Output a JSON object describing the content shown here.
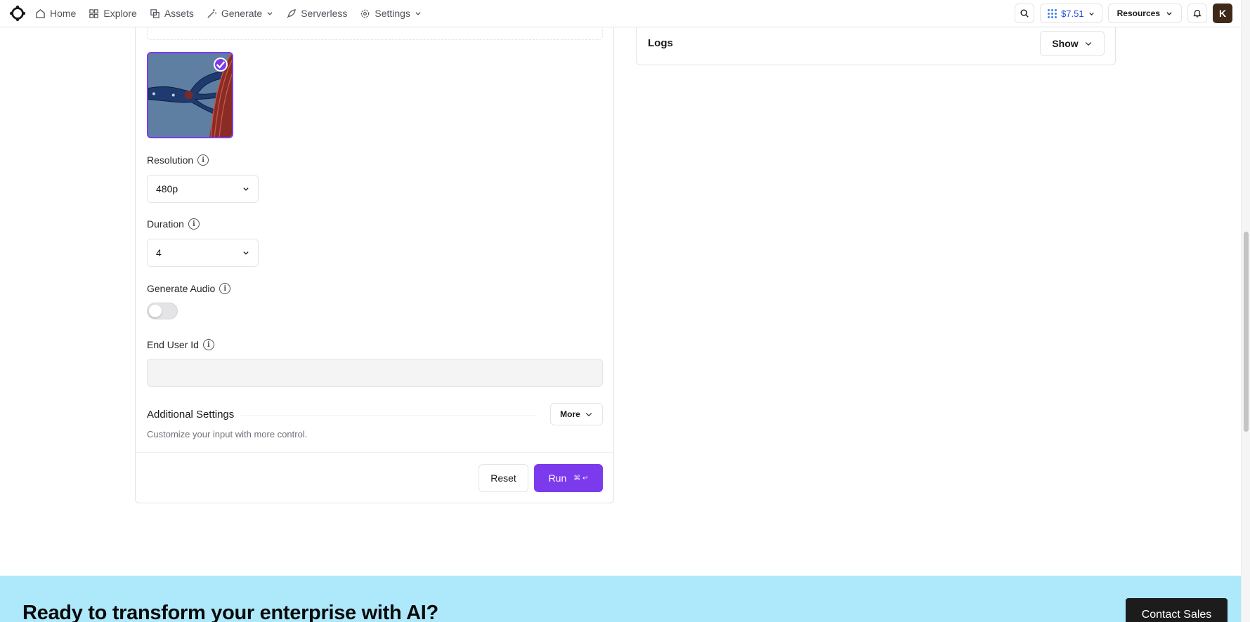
{
  "nav": {
    "items": [
      {
        "label": "Home",
        "icon": "home-icon"
      },
      {
        "label": "Explore",
        "icon": "grid-icon"
      },
      {
        "label": "Assets",
        "icon": "layers-icon"
      },
      {
        "label": "Generate",
        "icon": "wand-icon",
        "dropdown": true
      },
      {
        "label": "Serverless",
        "icon": "rocket-icon"
      },
      {
        "label": "Settings",
        "icon": "gear-icon",
        "dropdown": true
      }
    ],
    "credits": "$7.51",
    "resources_label": "Resources",
    "avatar_initial": "K"
  },
  "form": {
    "resolution": {
      "label": "Resolution",
      "value": "480p"
    },
    "duration": {
      "label": "Duration",
      "value": "4"
    },
    "generate_audio": {
      "label": "Generate Audio",
      "enabled": false
    },
    "end_user_id": {
      "label": "End User Id",
      "value": ""
    },
    "additional_settings": {
      "title": "Additional Settings",
      "more_label": "More",
      "description": "Customize your input with more control."
    },
    "reset_label": "Reset",
    "run_label": "Run",
    "run_shortcut": "⌘ ↵"
  },
  "logs": {
    "title": "Logs",
    "show_label": "Show"
  },
  "cta": {
    "title": "Ready to transform your enterprise with AI?",
    "button_label": "Contact Sales"
  },
  "colors": {
    "accent": "#7c3aed",
    "cta_bg": "#aee9fb",
    "credit_blue": "#1d4ed8"
  }
}
